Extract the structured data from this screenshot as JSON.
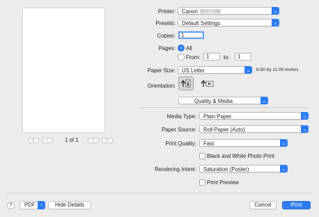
{
  "preview": {
    "page_indicator": "1 of 1",
    "first": "«",
    "prev": "‹",
    "next": "›",
    "last": "»"
  },
  "printer": {
    "label": "Printer:",
    "value": "Canon"
  },
  "presets": {
    "label": "Presets:",
    "value": "Default Settings"
  },
  "copies": {
    "label": "Copies:",
    "value": "1"
  },
  "pages": {
    "label": "Pages:",
    "all_label": "All",
    "from_label": "From:",
    "from_value": "1",
    "to_label": "to:",
    "to_value": "1"
  },
  "paper_size": {
    "label": "Paper Size:",
    "value": "US Letter",
    "dimensions": "8.50 by 11.00 inches"
  },
  "orientation": {
    "label": "Orientation:"
  },
  "section": {
    "value": "Quality & Media"
  },
  "media_type": {
    "label": "Media Type:",
    "value": "Plain Paper"
  },
  "paper_source": {
    "label": "Paper Source:",
    "value": "Roll Paper (Auto)"
  },
  "print_quality": {
    "label": "Print Quality:",
    "value": "Fast"
  },
  "bw_photo": {
    "label": "Black and White Photo Print"
  },
  "rendering_intent": {
    "label": "Rendering Intent:",
    "value": "Saturation (Poster)"
  },
  "print_preview": {
    "label": "Print Preview"
  },
  "footer": {
    "help": "?",
    "pdf": "PDF",
    "hide_details": "Hide Details",
    "cancel": "Cancel",
    "print": "Print"
  },
  "colors": {
    "accent": "#2d7cf6",
    "background": "#ececec"
  }
}
